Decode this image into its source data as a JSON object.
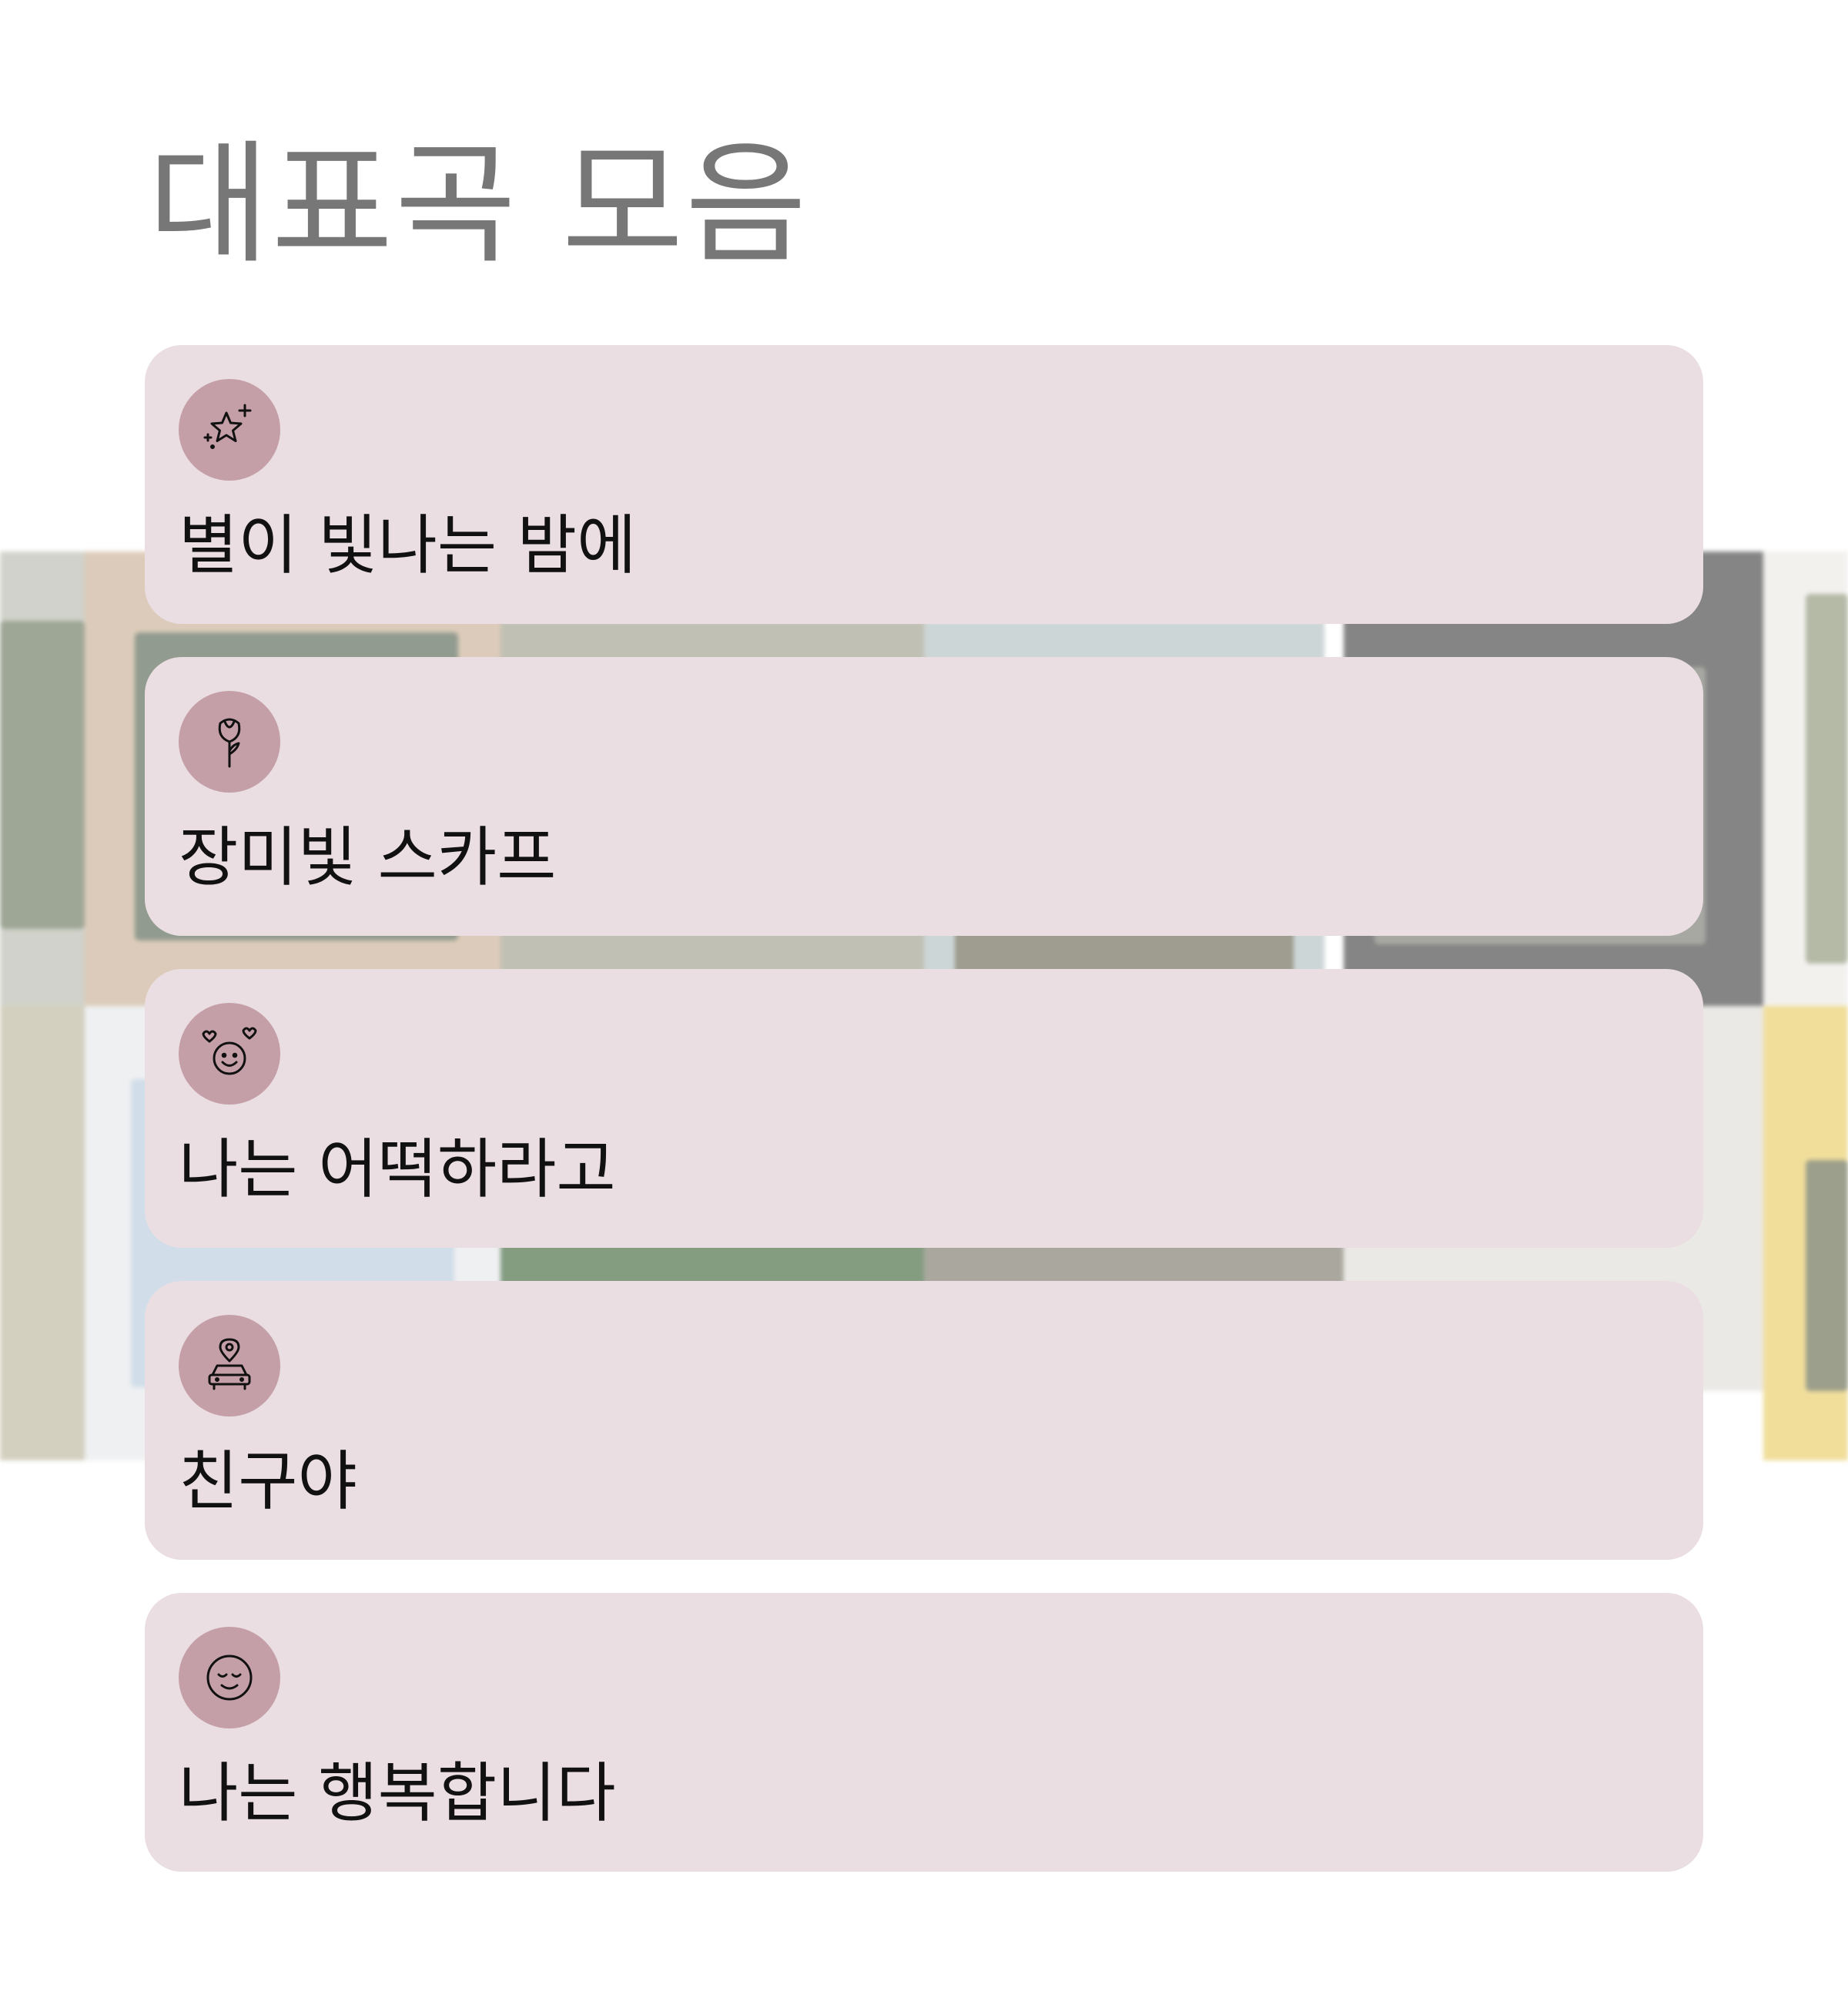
{
  "header": {
    "title": "대표곡 모음"
  },
  "songs": [
    {
      "title": "별이 빛나는 밤에",
      "icon": "sparkle-star-icon"
    },
    {
      "title": "장미빛 스카프",
      "icon": "rose-icon"
    },
    {
      "title": "나는 어떡하라고",
      "icon": "smiley-hearts-icon"
    },
    {
      "title": "친구야",
      "icon": "car-pin-icon"
    },
    {
      "title": "나는 행복합니다",
      "icon": "content-face-icon"
    }
  ],
  "colors": {
    "card_background": "#eadee2",
    "icon_badge": "#c49fa8",
    "title_text": "#777777",
    "song_text": "#111111"
  }
}
